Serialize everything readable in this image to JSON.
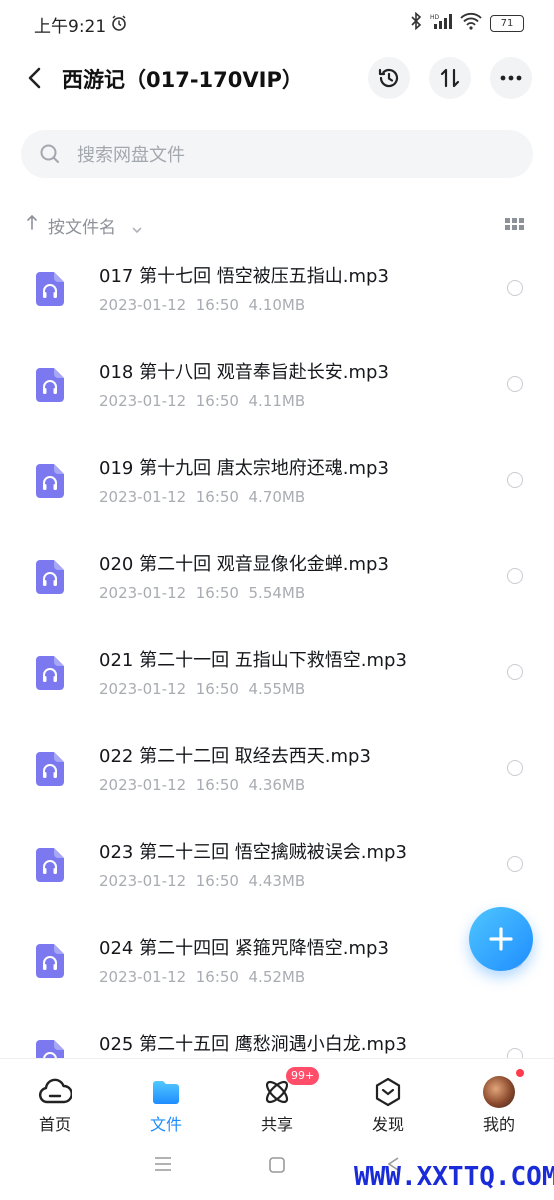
{
  "status_bar": {
    "time": "上午9:21",
    "battery": "71"
  },
  "header": {
    "title": "西游记（017-170VIP）"
  },
  "search": {
    "placeholder": "搜索网盘文件"
  },
  "sort": {
    "label": "按文件名"
  },
  "files": [
    {
      "name": "017 第十七回 悟空被压五指山.mp3",
      "date": "2023-01-12",
      "time": "16:50",
      "size": "4.10MB"
    },
    {
      "name": "018 第十八回 观音奉旨赴长安.mp3",
      "date": "2023-01-12",
      "time": "16:50",
      "size": "4.11MB"
    },
    {
      "name": "019 第十九回 唐太宗地府还魂.mp3",
      "date": "2023-01-12",
      "time": "16:50",
      "size": "4.70MB"
    },
    {
      "name": "020 第二十回 观音显像化金蝉.mp3",
      "date": "2023-01-12",
      "time": "16:50",
      "size": "5.54MB"
    },
    {
      "name": "021 第二十一回 五指山下救悟空.mp3",
      "date": "2023-01-12",
      "time": "16:50",
      "size": "4.55MB"
    },
    {
      "name": "022 第二十二回 取经去西天.mp3",
      "date": "2023-01-12",
      "time": "16:50",
      "size": "4.36MB"
    },
    {
      "name": "023 第二十三回 悟空擒贼被误会.mp3",
      "date": "2023-01-12",
      "time": "16:50",
      "size": "4.43MB"
    },
    {
      "name": "024 第二十四回 紧箍咒降悟空.mp3",
      "date": "2023-01-12",
      "time": "16:50",
      "size": "4.52MB"
    },
    {
      "name": "025 第二十五回 鹰愁涧遇小白龙.mp3",
      "date": "",
      "time": "",
      "size": ""
    }
  ],
  "bottom_nav": [
    {
      "label": "首页",
      "icon": "cloud-icon"
    },
    {
      "label": "文件",
      "icon": "folder-icon",
      "active": true
    },
    {
      "label": "共享",
      "icon": "share-atom-icon",
      "badge": "99+"
    },
    {
      "label": "发现",
      "icon": "discover-icon"
    },
    {
      "label": "我的",
      "icon": "avatar"
    }
  ],
  "watermark": "WWW.XXTTQ.COM",
  "colors": {
    "accent": "#1e8dff",
    "file_icon": "#7b78f0",
    "badge": "#ff4d6a"
  }
}
